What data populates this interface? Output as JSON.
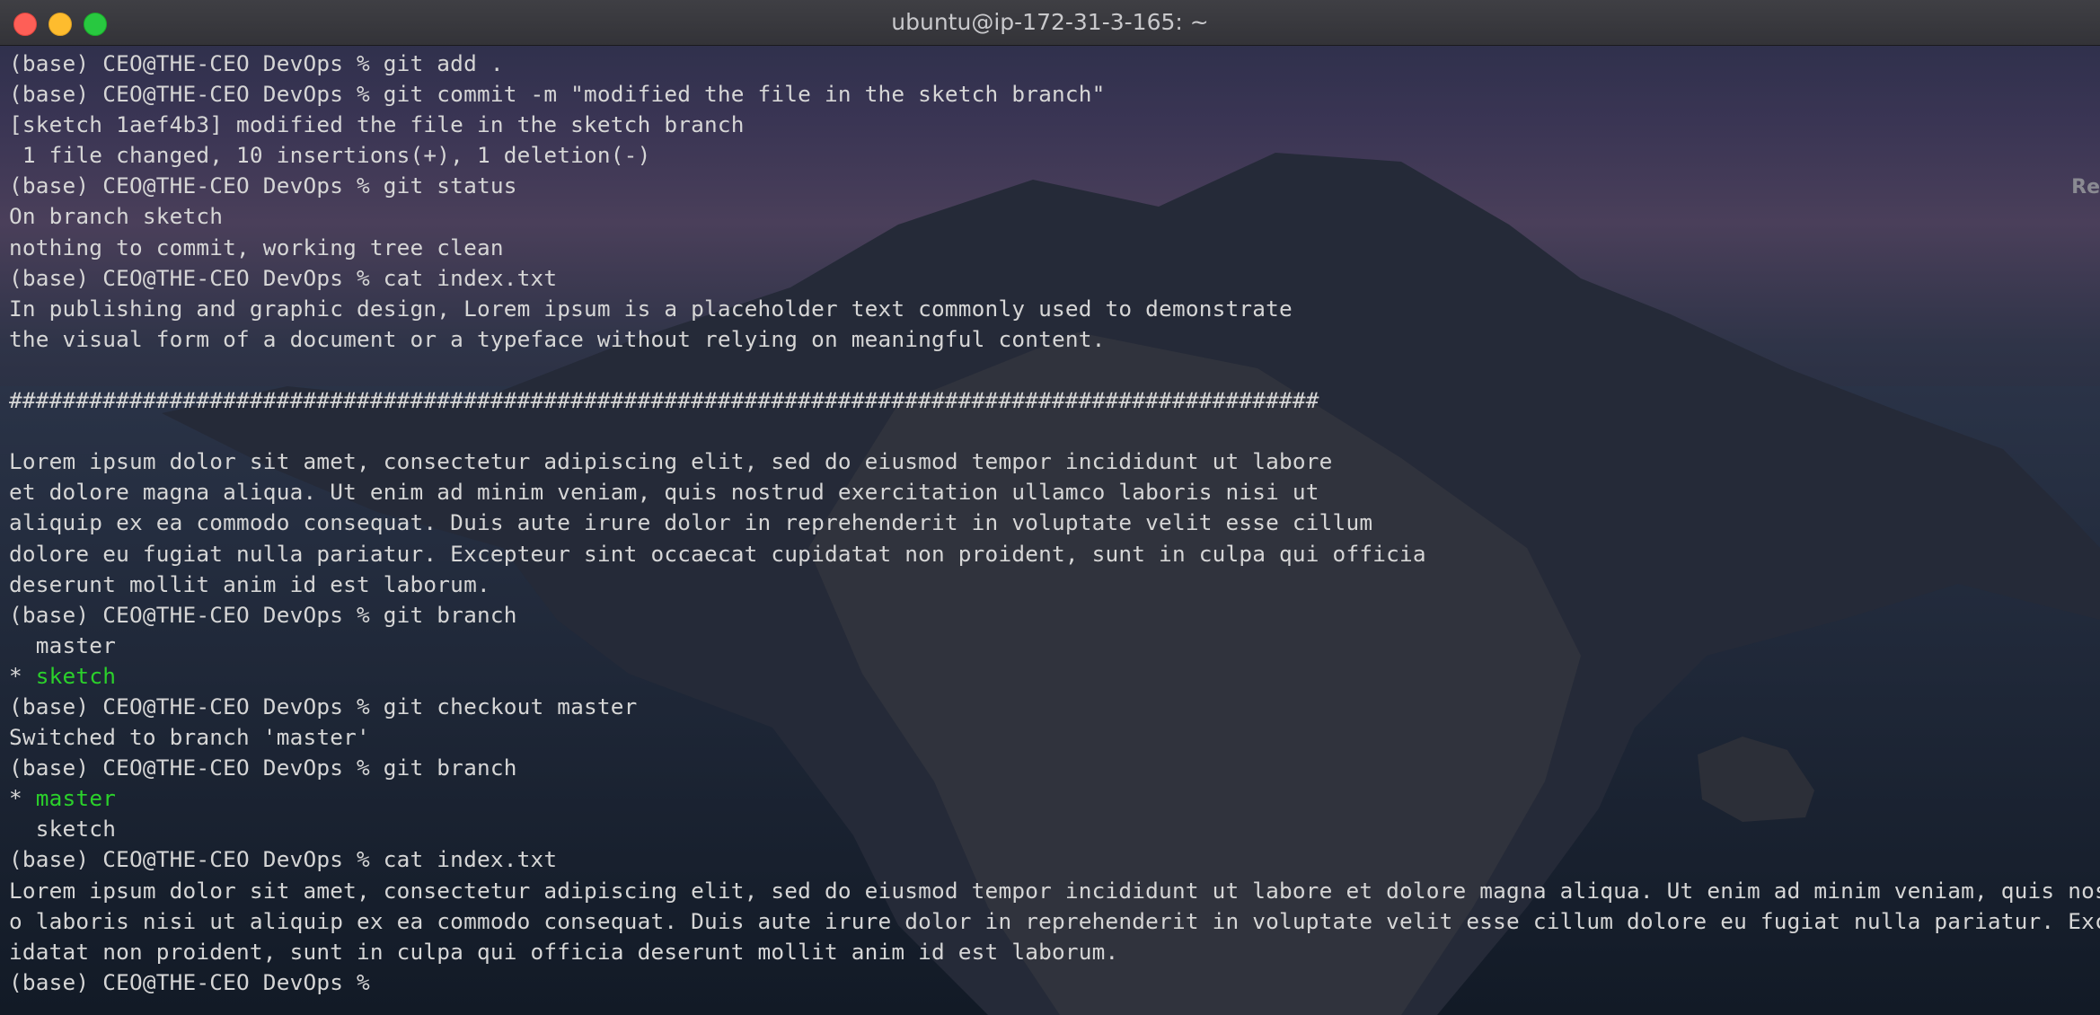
{
  "window": {
    "title": "ubuntu@ip-172-31-3-165: ~",
    "side_hint": "Re"
  },
  "colors": {
    "text": "#d6d6d6",
    "highlight": "#2bd12b",
    "close": "#fe5f57",
    "minimize": "#febc2e",
    "maximize": "#28c840"
  },
  "terminal": {
    "lines": [
      "(base) CEO@THE-CEO DevOps % git add .",
      "(base) CEO@THE-CEO DevOps % git commit -m \"modified the file in the sketch branch\"",
      "[sketch 1aef4b3] modified the file in the sketch branch",
      " 1 file changed, 10 insertions(+), 1 deletion(-)",
      "(base) CEO@THE-CEO DevOps % git status",
      "On branch sketch",
      "nothing to commit, working tree clean",
      "(base) CEO@THE-CEO DevOps % cat index.txt",
      "In publishing and graphic design, Lorem ipsum is a placeholder text commonly used to demonstrate",
      "the visual form of a document or a typeface without relying on meaningful content.",
      "",
      "##################################################################################################",
      "",
      "Lorem ipsum dolor sit amet, consectetur adipiscing elit, sed do eiusmod tempor incididunt ut labore",
      "et dolore magna aliqua. Ut enim ad minim veniam, quis nostrud exercitation ullamco laboris nisi ut",
      "aliquip ex ea commodo consequat. Duis aute irure dolor in reprehenderit in voluptate velit esse cillum",
      "dolore eu fugiat nulla pariatur. Excepteur sint occaecat cupidatat non proident, sunt in culpa qui officia",
      "deserunt mollit anim id est laborum.",
      "(base) CEO@THE-CEO DevOps % git branch",
      "  master",
      "* ",
      "(base) CEO@THE-CEO DevOps % git checkout master",
      "Switched to branch 'master'",
      "(base) CEO@THE-CEO DevOps % git branch",
      "* ",
      "  sketch",
      "(base) CEO@THE-CEO DevOps % cat index.txt",
      "Lorem ipsum dolor sit amet, consectetur adipiscing elit, sed do eiusmod tempor incididunt ut labore et dolore magna aliqua. Ut enim ad minim veniam, quis nostrud exerc",
      "o laboris nisi ut aliquip ex ea commodo consequat. Duis aute irure dolor in reprehenderit in voluptate velit esse cillum dolore eu fugiat nulla pariatur. Excepteur sin",
      "idatat non proident, sunt in culpa qui officia deserunt mollit anim id est laborum.",
      "(base) CEO@THE-CEO DevOps % "
    ],
    "current_branch_first": "sketch",
    "current_branch_second": "master"
  }
}
